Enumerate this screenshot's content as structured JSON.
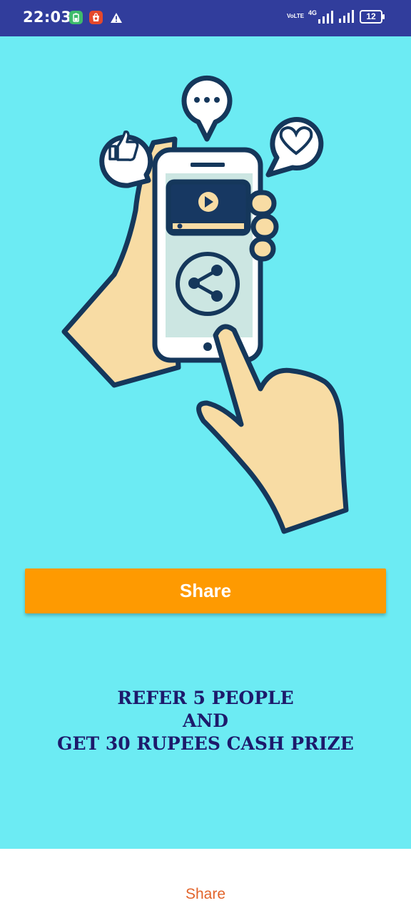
{
  "status_bar": {
    "time": "22:03",
    "volte_top": "VoLTE",
    "network": "4G",
    "battery": "12",
    "icons": [
      "battery-app-icon",
      "shop-icon",
      "warning-icon",
      "signal-icon",
      "battery-icon"
    ]
  },
  "main": {
    "share_button": "Share",
    "promo_lines": [
      "REFER 5 PEOPLE",
      "AND",
      "GET 30 RUPEES CASH PRIZE"
    ]
  },
  "bottom_bar": {
    "share_label": "Share"
  },
  "colors": {
    "background": "#6cebf3",
    "status_bar": "#313d9c",
    "button": "#fe9a01",
    "promo_text": "#1d1a6b",
    "bottom_link": "#e2642b"
  }
}
